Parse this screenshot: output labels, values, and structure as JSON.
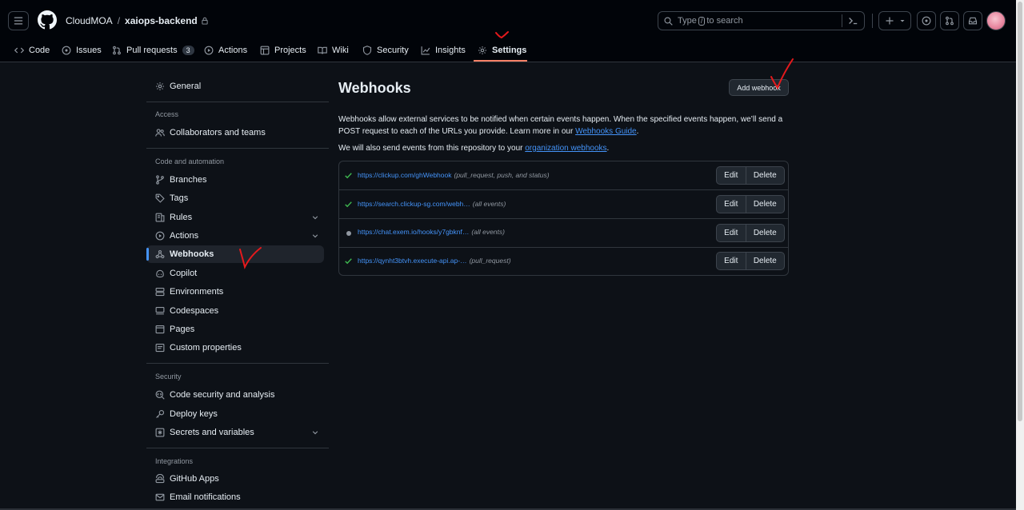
{
  "header": {
    "owner": "CloudMOA",
    "separator": "/",
    "repo": "xaiops-backend",
    "search_placeholder_pre": "Type",
    "search_key": "/",
    "search_placeholder_post": "to search"
  },
  "tabs": [
    {
      "label": "Code",
      "icon": "code-icon"
    },
    {
      "label": "Issues",
      "icon": "issue-icon"
    },
    {
      "label": "Pull requests",
      "icon": "pull-request-icon",
      "count": "3"
    },
    {
      "label": "Actions",
      "icon": "play-icon"
    },
    {
      "label": "Projects",
      "icon": "table-icon"
    },
    {
      "label": "Wiki",
      "icon": "book-icon"
    },
    {
      "label": "Security",
      "icon": "shield-icon"
    },
    {
      "label": "Insights",
      "icon": "graph-icon"
    },
    {
      "label": "Settings",
      "icon": "gear-icon",
      "active": true
    }
  ],
  "sidebar": {
    "general": "General",
    "access_heading": "Access",
    "collaborators": "Collaborators and teams",
    "code_heading": "Code and automation",
    "branches": "Branches",
    "tags": "Tags",
    "rules": "Rules",
    "actions": "Actions",
    "webhooks": "Webhooks",
    "copilot": "Copilot",
    "environments": "Environments",
    "codespaces": "Codespaces",
    "pages": "Pages",
    "custom_properties": "Custom properties",
    "security_heading": "Security",
    "code_security": "Code security and analysis",
    "deploy_keys": "Deploy keys",
    "secrets": "Secrets and variables",
    "integrations_heading": "Integrations",
    "github_apps": "GitHub Apps",
    "email_notifications": "Email notifications"
  },
  "main": {
    "title": "Webhooks",
    "add_button": "Add webhook",
    "description": "Webhooks allow external services to be notified when certain events happen. When the specified events happen, we’ll send a POST request to each of the URLs you provide. Learn more in our ",
    "guide_link": "Webhooks Guide",
    "description_end": ".",
    "org_text": "We will also send events from this repository to your ",
    "org_link": "organization webhooks",
    "org_end": ".",
    "edit_label": "Edit",
    "delete_label": "Delete",
    "webhooks": [
      {
        "url": "https://clickup.com/ghWebhook",
        "events": "(pull_request, push, and status)",
        "status": "success"
      },
      {
        "url": "https://search.clickup-sg.com/webh…",
        "events": "(all events)",
        "status": "success"
      },
      {
        "url": "https://chat.exem.io/hooks/y7gbknf…",
        "events": "(all events)",
        "status": "inactive"
      },
      {
        "url": "https://qynht3btvh.execute-api.ap-…",
        "events": "(pull_request)",
        "status": "success"
      }
    ]
  },
  "colors": {
    "accent": "#4493f8",
    "success": "#3fb950",
    "tab_underline": "#f78166",
    "annotation": "#e5191c"
  }
}
